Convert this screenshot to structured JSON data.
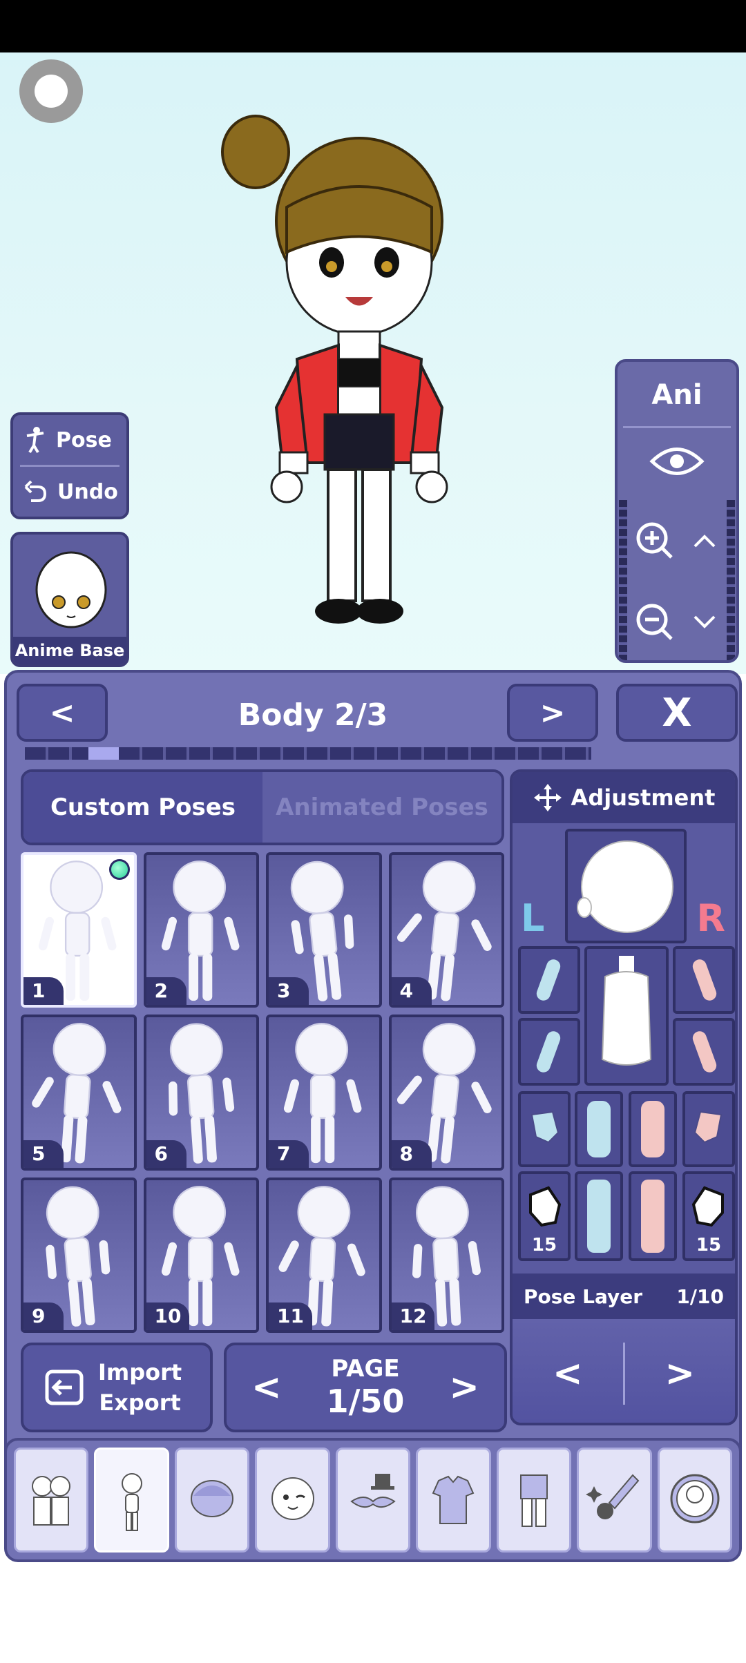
{
  "stage": {
    "pose_label": "Pose",
    "undo_label": "Undo",
    "anime_base_label": "Anime Base",
    "ani_label": "Ani"
  },
  "panel": {
    "title": "Body 2/3",
    "close_label": "X",
    "prev_label": "<",
    "next_label": ">"
  },
  "tabs": {
    "custom": "Custom Poses",
    "animated": "Animated Poses"
  },
  "poses": [
    "1",
    "2",
    "3",
    "4",
    "5",
    "6",
    "7",
    "8",
    "9",
    "10",
    "11",
    "12"
  ],
  "import_export": {
    "line1": "Import",
    "line2": "Export"
  },
  "pagination": {
    "label": "PAGE",
    "value": "1/50",
    "prev": "<",
    "next": ">"
  },
  "adjustment": {
    "title": "Adjustment",
    "left_label": "L",
    "right_label": "R",
    "left_hand_count": "15",
    "right_hand_count": "15",
    "pose_layer_label": "Pose Layer",
    "pose_layer_value": "1/10",
    "prev": "<",
    "next": ">"
  },
  "categories": [
    "characters-icon",
    "body-icon",
    "hair-icon",
    "face-icon",
    "accessories-icon",
    "top-clothing-icon",
    "bottom-clothing-icon",
    "props-icon",
    "profile-icon"
  ],
  "colors": {
    "panel": "#7272b4",
    "dark": "#3a3a78",
    "stage": "#e4f8f9",
    "left_label": "#7ec9ea",
    "right_label": "#f47b8f"
  }
}
